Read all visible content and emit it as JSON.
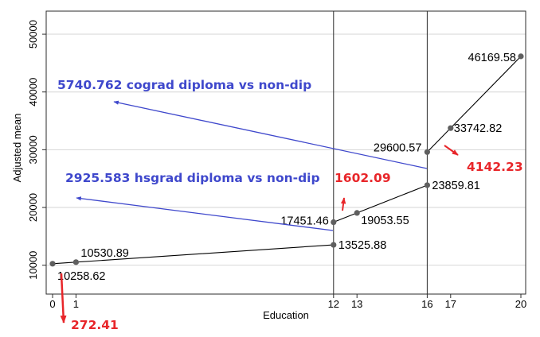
{
  "chart_data": {
    "type": "line",
    "xlabel": "Education",
    "ylabel": "Adjusted mean",
    "xlim": [
      0,
      20
    ],
    "ylim": [
      5000,
      54000
    ],
    "x_ticks": [
      0,
      1,
      12,
      13,
      16,
      17,
      20
    ],
    "y_ticks": [
      10000,
      20000,
      30000,
      40000,
      50000
    ],
    "grid": true,
    "vertical_lines": [
      12,
      16
    ],
    "colors": {
      "frame": "#2b2b2b",
      "grid": "#d6d6d6",
      "line": "#000000",
      "marker": "#5f5f5f",
      "blue": "#3f48cc",
      "red": "#e8262a"
    },
    "segments": [
      {
        "x": [
          0,
          1,
          12
        ],
        "y": [
          10258.62,
          10530.89,
          13525.88
        ]
      },
      {
        "x": [
          12,
          13,
          16
        ],
        "y": [
          17451.46,
          19053.55,
          23859.81
        ]
      },
      {
        "x": [
          16,
          17,
          20
        ],
        "y": [
          29600.57,
          33742.82,
          46169.58
        ]
      }
    ],
    "points": [
      {
        "x": 0,
        "y": 10258.62,
        "label": "10258.62"
      },
      {
        "x": 1,
        "y": 10530.89,
        "label": "10530.89"
      },
      {
        "x": 12,
        "y": 13525.88,
        "label": "13525.88"
      },
      {
        "x": 12,
        "y": 17451.46,
        "label": "17451.46"
      },
      {
        "x": 13,
        "y": 19053.55,
        "label": "19053.55"
      },
      {
        "x": 16,
        "y": 23859.81,
        "label": "23859.81"
      },
      {
        "x": 16,
        "y": 29600.57,
        "label": "29600.57"
      },
      {
        "x": 17,
        "y": 33742.82,
        "label": "33742.82"
      },
      {
        "x": 20,
        "y": 46169.58,
        "label": "46169.58"
      }
    ],
    "annotations": [
      {
        "text": "5740.762 cograd diploma vs non-dip",
        "color": "blue"
      },
      {
        "text": "2925.583 hsgrad diploma  vs non-dip",
        "color": "blue"
      },
      {
        "text": "1602.09",
        "color": "red"
      },
      {
        "text": "4142.23",
        "color": "red"
      },
      {
        "text": "272.41",
        "color": "red"
      }
    ]
  }
}
